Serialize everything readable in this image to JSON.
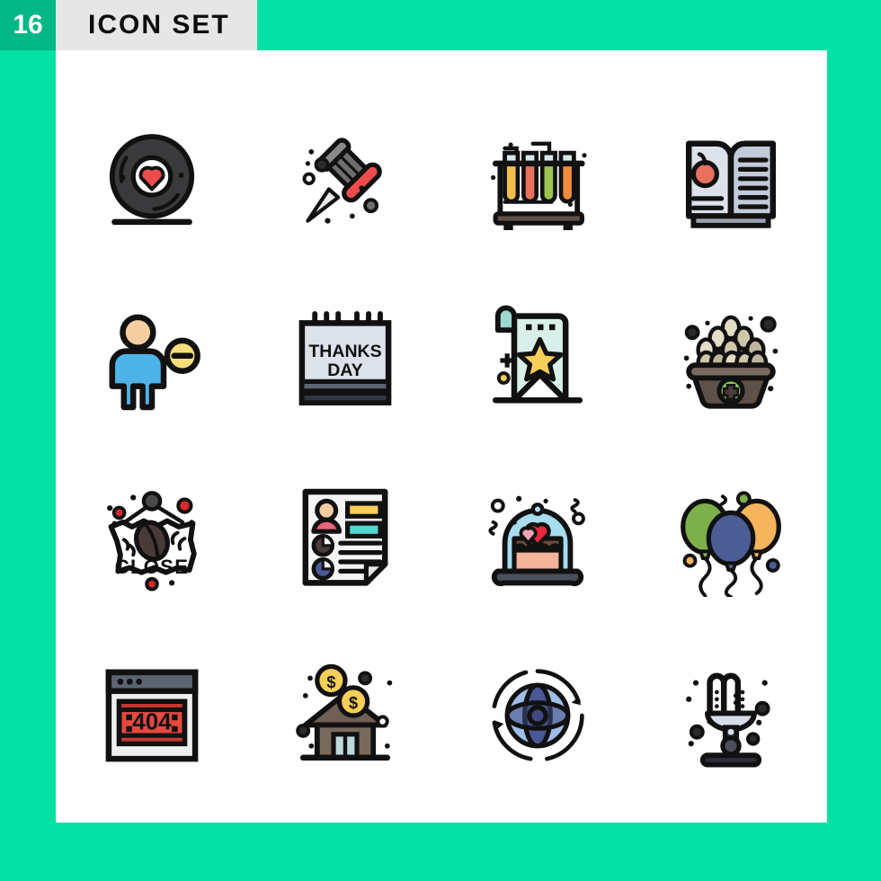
{
  "header": {
    "count": "16",
    "title": "ICON SET",
    "badge_color": "#00B786",
    "title_bg_color": "#E6E6E6",
    "background_color": "#05E0A5"
  },
  "panel": {
    "background_color": "#FFFFFF"
  },
  "grid": {
    "columns": 4,
    "rows": 4,
    "icons": [
      {
        "name": "vinyl-record-heart-icon",
        "label": "Vinyl Record With Heart",
        "colors": [
          "#3A3A3C",
          "#ED4C4C",
          "#FFFFFF",
          "#111111"
        ]
      },
      {
        "name": "push-pin-icon",
        "label": "Push Pin",
        "colors": [
          "#EE4B4B",
          "#6E6E6E",
          "#2B2B2B",
          "#111111"
        ]
      },
      {
        "name": "test-tube-rack-icon",
        "label": "Test Tube Rack",
        "colors": [
          "#F2C04A",
          "#E8705F",
          "#9BC453",
          "#EE8B3C",
          "#CFE6E6"
        ]
      },
      {
        "name": "open-book-apple-icon",
        "label": "Open Book With Apple",
        "colors": [
          "#C3CAD9",
          "#DCE1EA",
          "#E8705F",
          "#111111"
        ]
      },
      {
        "name": "remove-user-icon",
        "label": "Remove User",
        "colors": [
          "#4EB3E8",
          "#F6CDA0",
          "#F6DE7B",
          "#111111"
        ]
      },
      {
        "name": "thanks-day-calendar-icon",
        "label": "Thanks Day Calendar",
        "colors": [
          "#DCE1EA",
          "#5B6472",
          "#111111"
        ],
        "text": [
          "THANKS",
          "DAY"
        ]
      },
      {
        "name": "star-banner-icon",
        "label": "Star Banner",
        "colors": [
          "#D9EFEA",
          "#F6CE58",
          "#9ED8D2",
          "#111111"
        ]
      },
      {
        "name": "egg-basket-icon",
        "label": "Egg Basket With Plus",
        "colors": [
          "#5E5148",
          "#4A4039",
          "#E3DCC6",
          "#8CBF5A",
          "#111111"
        ]
      },
      {
        "name": "close-sign-icon",
        "label": "Close Sign",
        "colors": [
          "#FFFFFF",
          "#D42A2A",
          "#4A3B38",
          "#111111"
        ],
        "text": [
          "CLOSE"
        ]
      },
      {
        "name": "resume-document-icon",
        "label": "Resume Document",
        "colors": [
          "#F5F5F5",
          "#F6CE58",
          "#4DD9D2",
          "#E8647A",
          "#F6CDA0",
          "#4A3B38",
          "#4A5897"
        ]
      },
      {
        "name": "cake-dome-heart-icon",
        "label": "Cake Under Dome With Heart",
        "colors": [
          "#A8DCEF",
          "#6B4A3A",
          "#F3B49B",
          "#E8293B",
          "#4A4F5A"
        ]
      },
      {
        "name": "balloons-icon",
        "label": "Party Balloons",
        "colors": [
          "#7DB04A",
          "#4C5C94",
          "#F6B45C",
          "#111111"
        ]
      },
      {
        "name": "error-404-browser-icon",
        "label": "404 Error Browser Window",
        "colors": [
          "#5B6472",
          "#EFEFEF",
          "#E8483F",
          "#C8372F",
          "#111111"
        ],
        "text": [
          "404"
        ]
      },
      {
        "name": "house-money-icon",
        "label": "House With Money",
        "colors": [
          "#6F5F55",
          "#5B4C44",
          "#F6CE58",
          "#BFD8DD",
          "#111111"
        ]
      },
      {
        "name": "global-network-icon",
        "label": "Global Network Globe",
        "colors": [
          "#9FBDE8",
          "#4A5897",
          "#3E4A80",
          "#111111"
        ]
      },
      {
        "name": "water-fountain-icon",
        "label": "Water Fountain",
        "colors": [
          "#D7DCE8",
          "#2B2F38",
          "#111111"
        ]
      }
    ]
  }
}
